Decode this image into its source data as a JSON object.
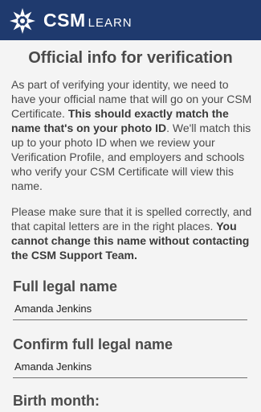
{
  "app": {
    "brand_main": "CSM",
    "brand_sub": "LEARN"
  },
  "colors": {
    "header_bg": "#1f3a6e",
    "background": "#f4f4f4"
  },
  "page": {
    "title": "Official info for verification",
    "intro": {
      "text1": "As part of verifying your identity, we need to have your official name that will go on your CSM Certificate. ",
      "bold1": "This should exactly match the name that's on your photo ID",
      "text2": ". We'll match this up to your photo ID when we review your Verification Profile, and employers and schools who verify your CSM Certificate will view this name."
    },
    "notice": {
      "text1": "Please make sure that it is spelled correctly, and that capital letters are in the right places. ",
      "bold1": "You cannot change this name without contacting the CSM Support Team."
    }
  },
  "form": {
    "full_name": {
      "label": "Full legal name",
      "value": "Amanda Jenkins"
    },
    "confirm_name": {
      "label": "Confirm full legal name",
      "value": "Amanda Jenkins"
    },
    "birth_month": {
      "label": "Birth month:"
    }
  }
}
